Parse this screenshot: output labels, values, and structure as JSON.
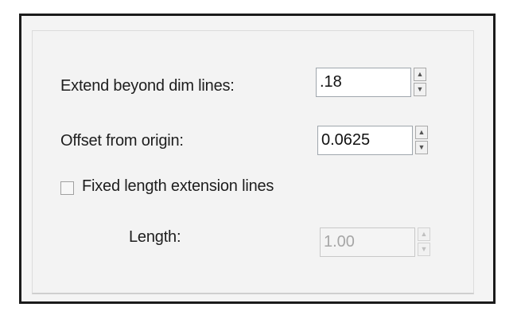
{
  "options": {
    "extend_beyond": {
      "label": "Extend beyond dim lines:",
      "value": ".18"
    },
    "offset_from_origin": {
      "label": "Offset from origin:",
      "value": "0.0625"
    },
    "fixed_length": {
      "label": "Fixed length extension lines",
      "checked": false
    },
    "length": {
      "label": "Length:",
      "value": "1.00",
      "enabled": false
    }
  },
  "icons": {
    "spinner_up": "▲",
    "spinner_down": "▼"
  }
}
